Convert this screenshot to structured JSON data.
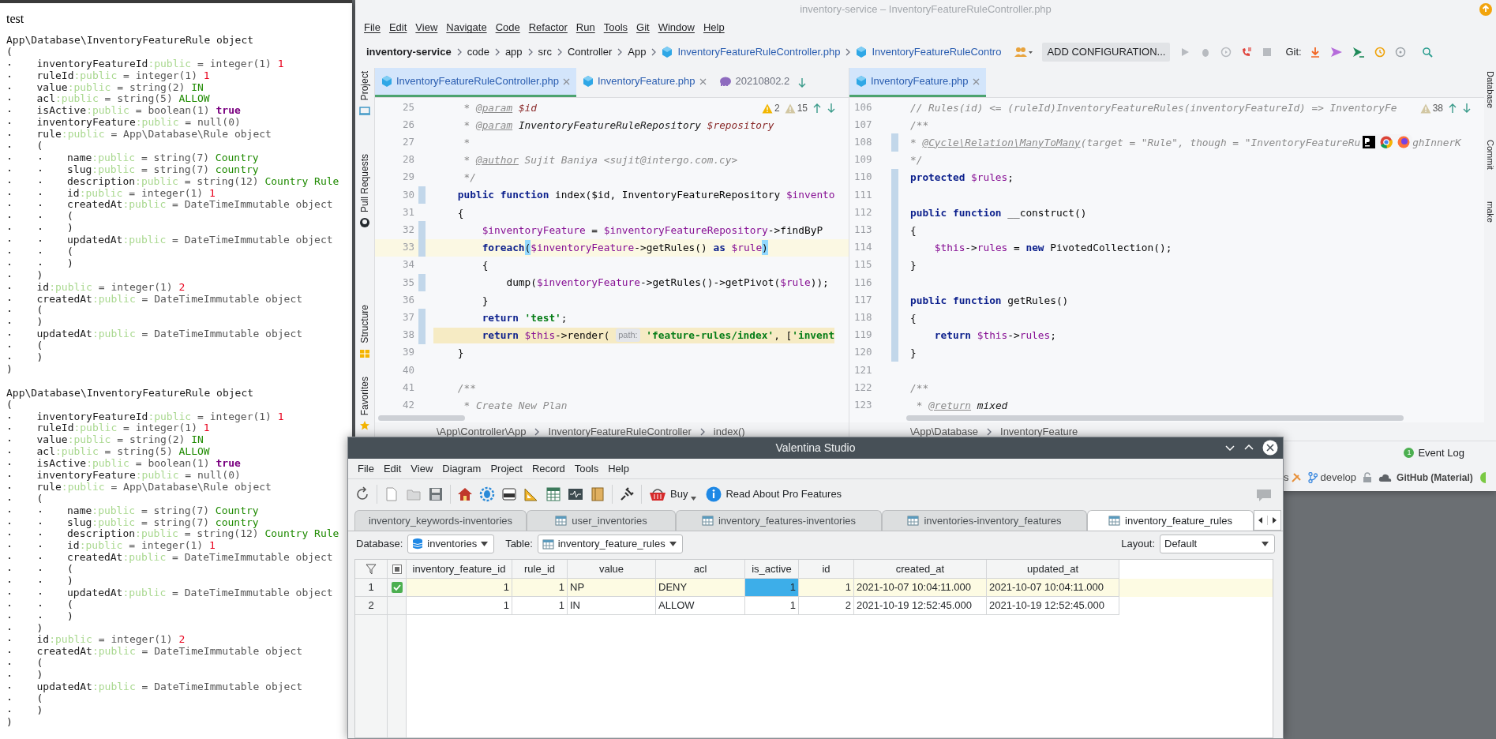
{
  "browser_output": {
    "heading": "test",
    "dumps": [
      {
        "type": "App\\Database\\InventoryFeatureRule object",
        "open": "(",
        "close": ")",
        "children": [
          {
            "name": "inventoryFeatureId",
            "access": ":public",
            "type": "= integer(1)",
            "value": "1",
            "kind": "int"
          },
          {
            "name": "ruleId",
            "access": ":public",
            "type": "= integer(1)",
            "value": "1",
            "kind": "int"
          },
          {
            "name": "value",
            "access": ":public",
            "type": "= string(2)",
            "value": "IN",
            "kind": "string"
          },
          {
            "name": "acl",
            "access": ":public",
            "type": "= string(5)",
            "value": "ALLOW",
            "kind": "string"
          },
          {
            "name": "isActive",
            "access": ":public",
            "type": "= boolean(1)",
            "value": "true",
            "kind": "bool"
          },
          {
            "name": "inventoryFeature",
            "access": ":public",
            "type": "= null(0)"
          },
          {
            "name": "rule",
            "access": ":public",
            "type": "= App\\Database\\Rule object",
            "open": "(",
            "close": ")",
            "children": [
              {
                "name": "name",
                "access": ":public",
                "type": "= string(7)",
                "value": "Country",
                "kind": "string"
              },
              {
                "name": "slug",
                "access": ":public",
                "type": "= string(7)",
                "value": "country",
                "kind": "string"
              },
              {
                "name": "description",
                "access": ":public",
                "type": "= string(12)",
                "value": "Country Rule",
                "kind": "string"
              },
              {
                "name": "id",
                "access": ":public",
                "type": "= integer(1)",
                "value": "1",
                "kind": "int"
              },
              {
                "name": "createdAt",
                "access": ":public",
                "type": "= DateTimeImmutable object",
                "open": "(",
                "close": ")"
              },
              {
                "name": "updatedAt",
                "access": ":public",
                "type": "= DateTimeImmutable object",
                "open": "(",
                "close": ")"
              }
            ]
          },
          {
            "name": "id",
            "access": ":public",
            "type": "= integer(1)",
            "value": "2",
            "kind": "int"
          },
          {
            "name": "createdAt",
            "access": ":public",
            "type": "= DateTimeImmutable object",
            "open": "(",
            "close": ")"
          },
          {
            "name": "updatedAt",
            "access": ":public",
            "type": "= DateTimeImmutable object",
            "open": "(",
            "close": ")"
          }
        ]
      },
      {
        "type": "App\\Database\\InventoryFeatureRule object",
        "open": "(",
        "close": ")",
        "children": [
          {
            "name": "inventoryFeatureId",
            "access": ":public",
            "type": "= integer(1)",
            "value": "1",
            "kind": "int"
          },
          {
            "name": "ruleId",
            "access": ":public",
            "type": "= integer(1)",
            "value": "1",
            "kind": "int"
          },
          {
            "name": "value",
            "access": ":public",
            "type": "= string(2)",
            "value": "IN",
            "kind": "string"
          },
          {
            "name": "acl",
            "access": ":public",
            "type": "= string(5)",
            "value": "ALLOW",
            "kind": "string"
          },
          {
            "name": "isActive",
            "access": ":public",
            "type": "= boolean(1)",
            "value": "true",
            "kind": "bool"
          },
          {
            "name": "inventoryFeature",
            "access": ":public",
            "type": "= null(0)"
          },
          {
            "name": "rule",
            "access": ":public",
            "type": "= App\\Database\\Rule object",
            "open": "(",
            "close": ")",
            "children": [
              {
                "name": "name",
                "access": ":public",
                "type": "= string(7)",
                "value": "Country",
                "kind": "string"
              },
              {
                "name": "slug",
                "access": ":public",
                "type": "= string(7)",
                "value": "country",
                "kind": "string"
              },
              {
                "name": "description",
                "access": ":public",
                "type": "= string(12)",
                "value": "Country Rule",
                "kind": "string"
              },
              {
                "name": "id",
                "access": ":public",
                "type": "= integer(1)",
                "value": "1",
                "kind": "int"
              },
              {
                "name": "createdAt",
                "access": ":public",
                "type": "= DateTimeImmutable object",
                "open": "(",
                "close": ")"
              },
              {
                "name": "updatedAt",
                "access": ":public",
                "type": "= DateTimeImmutable object",
                "open": "(",
                "close": ")"
              }
            ]
          },
          {
            "name": "id",
            "access": ":public",
            "type": "= integer(1)",
            "value": "2",
            "kind": "int"
          },
          {
            "name": "createdAt",
            "access": ":public",
            "type": "= DateTimeImmutable object",
            "open": "(",
            "close": ")"
          },
          {
            "name": "updatedAt",
            "access": ":public",
            "type": "= DateTimeImmutable object",
            "open": "(",
            "close": ")"
          }
        ]
      }
    ]
  },
  "ide": {
    "title": "inventory-service – InventoryFeatureRuleController.php",
    "menu": [
      "File",
      "Edit",
      "View",
      "Navigate",
      "Code",
      "Refactor",
      "Run",
      "Tools",
      "Git",
      "Window",
      "Help"
    ],
    "breadcrumbs": [
      {
        "text": "inventory-service",
        "kind": "project"
      },
      {
        "text": "code",
        "kind": "dir"
      },
      {
        "text": "app",
        "kind": "dir"
      },
      {
        "text": "src",
        "kind": "dir"
      },
      {
        "text": "Controller",
        "kind": "dir"
      },
      {
        "text": "App",
        "kind": "dir"
      },
      {
        "text": "InventoryFeatureRuleController.php",
        "kind": "file"
      },
      {
        "text": "InventoryFeatureRuleContro",
        "kind": "file"
      }
    ],
    "run_config": "ADD CONFIGURATION...",
    "git_label": "Git:",
    "left_tools": [
      "Project",
      "Pull Requests",
      "Structure",
      "Favorites"
    ],
    "right_tools": [
      "Database",
      "Commit",
      "make"
    ],
    "left_tabs": [
      {
        "label": "InventoryFeatureRuleController.php",
        "kind": "php",
        "selected": true
      },
      {
        "label": "InventoryFeature.php",
        "kind": "php",
        "selected": false
      },
      {
        "label": "20210802.2",
        "kind": "db",
        "selected": false
      }
    ],
    "right_tabs": [
      {
        "label": "InventoryFeature.php",
        "kind": "php",
        "selected": true
      }
    ],
    "left_editor": {
      "problems": [
        {
          "kind": "warning",
          "count": "2"
        },
        {
          "kind": "weak",
          "count": "15"
        }
      ],
      "lines": [
        {
          "number": "25",
          "tokens": [
            {
              "kind": "doc",
              "text": "     * "
            },
            {
              "kind": "doctag",
              "text": "@param"
            },
            {
              "kind": "docvar",
              "text": " $id"
            }
          ]
        },
        {
          "number": "26",
          "tokens": [
            {
              "kind": "doc",
              "text": "     * "
            },
            {
              "kind": "doctag",
              "text": "@param"
            },
            {
              "kind": "doctype",
              "text": " InventoryFeatureRuleRepository "
            },
            {
              "kind": "docvar",
              "text": "$repository"
            }
          ]
        },
        {
          "number": "27",
          "tokens": [
            {
              "kind": "doc",
              "text": "     *"
            }
          ]
        },
        {
          "number": "28",
          "tokens": [
            {
              "kind": "doc",
              "text": "     * "
            },
            {
              "kind": "doctag",
              "text": "@author"
            },
            {
              "kind": "doc",
              "text": " Sujit Baniya <sujit@intergo.com.cy>"
            }
          ]
        },
        {
          "number": "29",
          "tokens": [
            {
              "kind": "doc",
              "text": "     */"
            }
          ]
        },
        {
          "number": "30",
          "changed": true,
          "tokens": [
            {
              "kind": "keyword",
              "text": "    public function"
            },
            {
              "kind": "plain",
              "text": " index($id, InventoryFeatureRepository "
            },
            {
              "kind": "var",
              "text": "$invento"
            }
          ]
        },
        {
          "number": "31",
          "tokens": [
            {
              "kind": "plain",
              "text": "    {"
            }
          ]
        },
        {
          "number": "32",
          "changed": true,
          "tokens": [
            {
              "kind": "var",
              "text": "        $inventoryFeature"
            },
            {
              "kind": "plain",
              "text": " = "
            },
            {
              "kind": "var",
              "text": "$inventoryFeatureRepository"
            },
            {
              "kind": "plain",
              "text": "->findByP"
            }
          ]
        },
        {
          "number": "33",
          "changed": true,
          "caret_line": true,
          "tokens": [
            {
              "kind": "keyword",
              "text": "        foreach"
            },
            {
              "kind": "match",
              "text": "("
            },
            {
              "kind": "var",
              "text": "$inventoryFeature"
            },
            {
              "kind": "plain",
              "text": "->getRules() "
            },
            {
              "kind": "keyword",
              "text": "as"
            },
            {
              "kind": "var",
              "text": " $rule"
            },
            {
              "kind": "match",
              "text": ")"
            }
          ]
        },
        {
          "number": "34",
          "tokens": [
            {
              "kind": "plain",
              "text": "        {"
            }
          ]
        },
        {
          "number": "35",
          "changed": true,
          "tokens": [
            {
              "kind": "plain",
              "text": "            dump("
            },
            {
              "kind": "var",
              "text": "$inventoryFeature"
            },
            {
              "kind": "plain",
              "text": "->getRules()->getPivot("
            },
            {
              "kind": "var",
              "text": "$rule"
            },
            {
              "kind": "plain",
              "text": "));"
            }
          ]
        },
        {
          "number": "36",
          "tokens": [
            {
              "kind": "plain",
              "text": "        }"
            }
          ]
        },
        {
          "number": "37",
          "changed": true,
          "tokens": [
            {
              "kind": "keyword",
              "text": "        return"
            },
            {
              "kind": "string",
              "text": " 'test'"
            },
            {
              "kind": "plain",
              "text": ";"
            }
          ]
        },
        {
          "number": "38",
          "changed": true,
          "warning": true,
          "tokens": [
            {
              "kind": "keyword",
              "text": "        return"
            },
            {
              "kind": "var",
              "text": " $this"
            },
            {
              "kind": "plain",
              "text": "->render( "
            },
            {
              "kind": "hint",
              "text": "path:"
            },
            {
              "kind": "string",
              "text": " 'feature-rules/index'"
            },
            {
              "kind": "plain",
              "text": ", ["
            },
            {
              "kind": "string",
              "text": "'invent"
            }
          ]
        },
        {
          "number": "39",
          "tokens": [
            {
              "kind": "plain",
              "text": "    }"
            }
          ]
        },
        {
          "number": "40"
        },
        {
          "number": "41",
          "tokens": [
            {
              "kind": "doc",
              "text": "    /**"
            }
          ]
        },
        {
          "number": "42",
          "tokens": [
            {
              "kind": "doc",
              "text": "     * Create New Plan"
            }
          ]
        }
      ],
      "path": [
        "\\App\\Controller\\App",
        "InventoryFeatureRuleController",
        "index()"
      ]
    },
    "right_editor": {
      "problems": [
        {
          "kind": "weak",
          "count": "38"
        }
      ],
      "lines": [
        {
          "number": "106",
          "tokens": [
            {
              "kind": "doc",
              "text": "// Rules(id) <= (ruleId)InventoryFeatureRules(inventoryFeatureId) => InventoryFe"
            }
          ]
        },
        {
          "number": "107",
          "tokens": [
            {
              "kind": "doc",
              "text": "/**"
            }
          ]
        },
        {
          "number": "108",
          "changed": true,
          "tokens": [
            {
              "kind": "doc",
              "text": "* "
            },
            {
              "kind": "doctag",
              "text": "@Cycle\\Relation\\ManyToMany"
            },
            {
              "kind": "doc",
              "text": "(target = \"Rule\", though = \"InventoryFeatureRu"
            },
            {
              "kind": "browser-popup"
            },
            {
              "kind": "doc",
              "text": "ghInnerK"
            }
          ]
        },
        {
          "number": "109",
          "tokens": [
            {
              "kind": "doc",
              "text": "*/"
            }
          ]
        },
        {
          "number": "110",
          "changed": true,
          "tokens": [
            {
              "kind": "keyword",
              "text": "protected"
            },
            {
              "kind": "var",
              "text": " $rules"
            },
            {
              "kind": "plain",
              "text": ";"
            }
          ]
        },
        {
          "number": "111",
          "changed": true
        },
        {
          "number": "112",
          "changed": true,
          "tokens": [
            {
              "kind": "keyword",
              "text": "public function"
            },
            {
              "kind": "plain",
              "text": " __construct()"
            }
          ]
        },
        {
          "number": "113",
          "changed": true,
          "tokens": [
            {
              "kind": "plain",
              "text": "{"
            }
          ]
        },
        {
          "number": "114",
          "changed": true,
          "tokens": [
            {
              "kind": "var",
              "text": "    $this"
            },
            {
              "kind": "plain",
              "text": "->"
            },
            {
              "kind": "var",
              "text": "rules"
            },
            {
              "kind": "plain",
              "text": " = "
            },
            {
              "kind": "keyword",
              "text": "new"
            },
            {
              "kind": "plain",
              "text": " PivotedCollection();"
            }
          ]
        },
        {
          "number": "115",
          "changed": true,
          "tokens": [
            {
              "kind": "plain",
              "text": "}"
            }
          ]
        },
        {
          "number": "116",
          "changed": true
        },
        {
          "number": "117",
          "changed": true,
          "tokens": [
            {
              "kind": "keyword",
              "text": "public function"
            },
            {
              "kind": "plain",
              "text": " getRules()"
            }
          ]
        },
        {
          "number": "118",
          "changed": true,
          "tokens": [
            {
              "kind": "plain",
              "text": "{"
            }
          ]
        },
        {
          "number": "119",
          "changed": true,
          "tokens": [
            {
              "kind": "keyword",
              "text": "    return"
            },
            {
              "kind": "var",
              "text": " $this"
            },
            {
              "kind": "plain",
              "text": "->"
            },
            {
              "kind": "var",
              "text": "rules"
            },
            {
              "kind": "plain",
              "text": ";"
            }
          ]
        },
        {
          "number": "120",
          "changed": true,
          "tokens": [
            {
              "kind": "plain",
              "text": "}"
            }
          ]
        },
        {
          "number": "121"
        },
        {
          "number": "122",
          "tokens": [
            {
              "kind": "doc",
              "text": "/**"
            }
          ]
        },
        {
          "number": "123",
          "tokens": [
            {
              "kind": "doc",
              "text": " * "
            },
            {
              "kind": "doctag",
              "text": "@return"
            },
            {
              "kind": "doctype",
              "text": " mixed"
            }
          ]
        }
      ],
      "path": [
        "\\App\\Database",
        "InventoryFeature"
      ]
    },
    "event_log": {
      "text": "Event Log",
      "count": "1"
    },
    "status_items": [
      {
        "kind": "tool",
        "text": "s"
      },
      {
        "kind": "branch",
        "text": "develop"
      },
      {
        "kind": "lock"
      },
      {
        "kind": "github",
        "text": "GitHub (Material)"
      },
      {
        "kind": "indicator"
      }
    ]
  },
  "valentina": {
    "title": "Valentina Studio",
    "menu": [
      "File",
      "Edit",
      "View",
      "Diagram",
      "Project",
      "Record",
      "Tools",
      "Help"
    ],
    "buy_label": "Buy",
    "pro_label": "Read About Pro Features",
    "tabs": [
      {
        "label": "inventory_keywords-inventories",
        "icon": false,
        "selected": false
      },
      {
        "label": "user_inventories",
        "icon": true,
        "selected": false
      },
      {
        "label": "inventory_features-inventories",
        "icon": true,
        "selected": false
      },
      {
        "label": "inventories-inventory_features",
        "icon": true,
        "selected": false
      },
      {
        "label": "inventory_feature_rules",
        "icon": true,
        "selected": true
      }
    ],
    "database_label": "Database:",
    "database": "inventories",
    "table_label": "Table:",
    "table": "inventory_feature_rules",
    "layout_label": "Layout:",
    "layout": "Default",
    "columns": [
      {
        "label": "inventory_feature_id",
        "numeric": true
      },
      {
        "label": "rule_id",
        "numeric": true
      },
      {
        "label": "value",
        "numeric": false
      },
      {
        "label": "acl",
        "numeric": false
      },
      {
        "label": "is_active",
        "numeric": true
      },
      {
        "label": "id",
        "numeric": true
      },
      {
        "label": "created_at",
        "numeric": false
      },
      {
        "label": "updated_at",
        "numeric": false
      }
    ],
    "rows": [
      {
        "number": "1",
        "checked": true,
        "current": true,
        "cells": [
          {
            "text": "1",
            "selected": false
          },
          {
            "text": "1",
            "selected": false
          },
          {
            "text": "NP",
            "selected": false
          },
          {
            "text": "DENY",
            "selected": false
          },
          {
            "text": "1",
            "selected": true
          },
          {
            "text": "1",
            "selected": false
          },
          {
            "text": "2021-10-07 10:04:11.000",
            "selected": false
          },
          {
            "text": "2021-10-07 10:04:11.000",
            "selected": false
          }
        ]
      },
      {
        "number": "2",
        "checked": false,
        "current": false,
        "cells": [
          {
            "text": "1",
            "selected": false
          },
          {
            "text": "1",
            "selected": false
          },
          {
            "text": "IN",
            "selected": false
          },
          {
            "text": "ALLOW",
            "selected": false
          },
          {
            "text": "1",
            "selected": false
          },
          {
            "text": "2",
            "selected": false
          },
          {
            "text": "2021-10-19 12:52:45.000",
            "selected": false
          },
          {
            "text": "2021-10-19 12:52:45.000",
            "selected": false
          }
        ]
      }
    ]
  }
}
